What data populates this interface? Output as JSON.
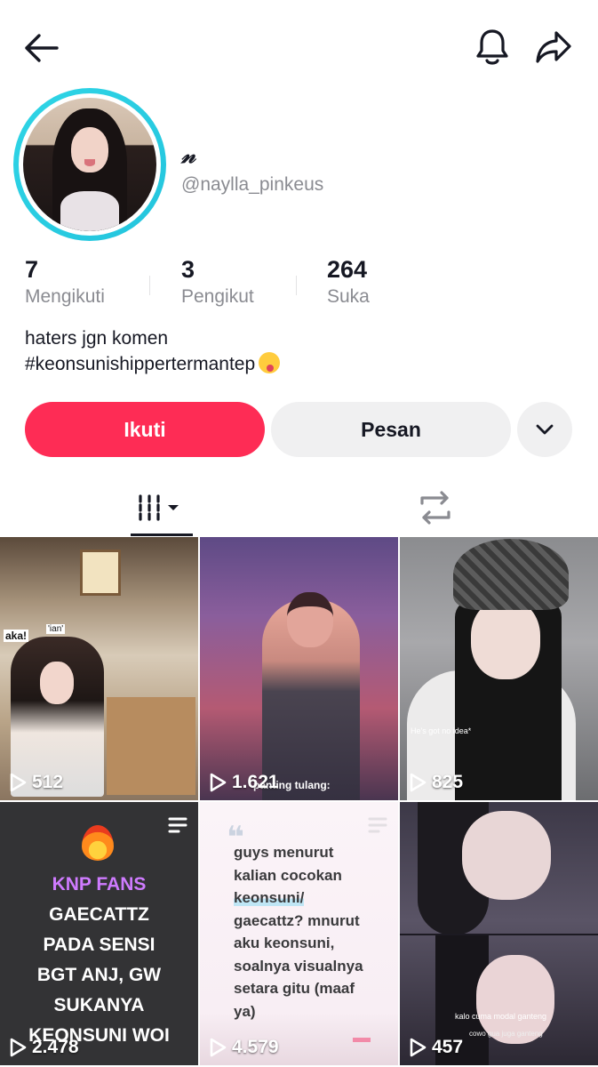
{
  "profile": {
    "display_name": "𝓃",
    "username": "@naylla_pinkeus",
    "bio_line1": "haters jgn komen",
    "bio_line2": "#keonsunishippertermantep"
  },
  "stats": [
    {
      "value": "7",
      "label": "Mengikuti"
    },
    {
      "value": "3",
      "label": "Pengikut"
    },
    {
      "value": "264",
      "label": "Suka"
    }
  ],
  "actions": {
    "follow_label": "Ikuti",
    "message_label": "Pesan"
  },
  "icons": {
    "back": "arrow-left-icon",
    "notifications": "bell-icon",
    "share": "share-arrow-icon",
    "more": "chevron-down-icon",
    "videos_tab": "grid-columns-icon",
    "reposts_tab": "repost-icon",
    "views": "play-icon"
  },
  "colors": {
    "follow": "#fe2c55",
    "avatar_ring": "#2fd5e6",
    "highlight_purple": "#cf7bff"
  },
  "videos": [
    {
      "views": "512",
      "overlay_left": "aka!",
      "overlay_tag": "'ian'"
    },
    {
      "views": "1.621",
      "overlay_caption": "panting tulang:"
    },
    {
      "views": "825",
      "overlay_caption": "He's got no idea*"
    },
    {
      "views": "2.478",
      "lines_highlight": "KNP FANS",
      "lines": [
        "GAECATTZ",
        "PADA SENSI",
        "BGT ANJ, GW",
        "SUKANYA",
        "KEONSUNI WOI"
      ]
    },
    {
      "views": "4.579",
      "lines": [
        "guys menurut",
        "kalian cocokan",
        "keonsuni/",
        "gaecattz? mnurut",
        "aku keonsuni,",
        "soalnya visualnya",
        "setara gitu (maaf",
        "ya)"
      ]
    },
    {
      "views": "457",
      "caption_1": "kalo cuma modal ganteng",
      "caption_2": "cowo gua juga ganteng"
    }
  ]
}
